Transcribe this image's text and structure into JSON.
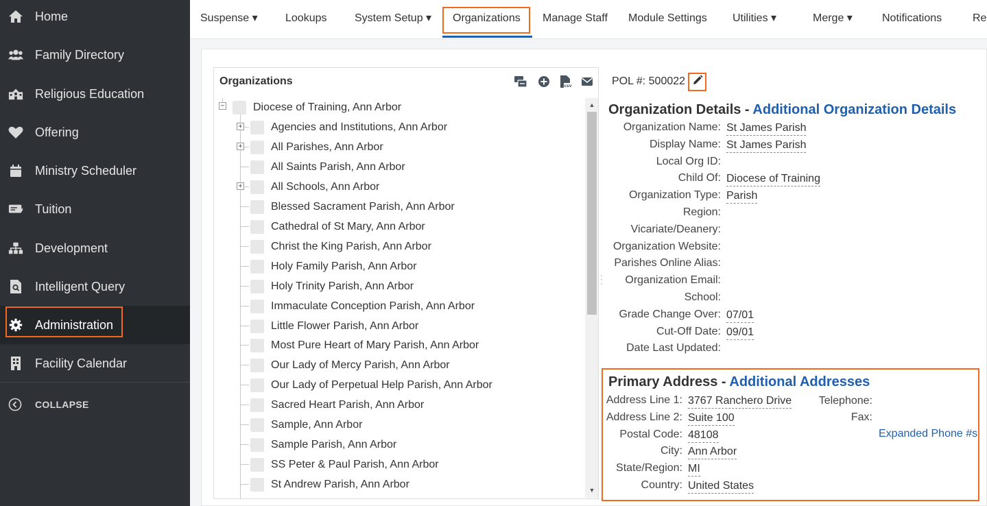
{
  "sidebar": {
    "items": [
      {
        "label": "Home",
        "icon": "home-icon"
      },
      {
        "label": "Family Directory",
        "icon": "users-icon"
      },
      {
        "label": "Religious Education",
        "icon": "school-icon"
      },
      {
        "label": "Offering",
        "icon": "heart-icon"
      },
      {
        "label": "Ministry Scheduler",
        "icon": "calendar-icon"
      },
      {
        "label": "Tuition",
        "icon": "money-icon"
      },
      {
        "label": "Development",
        "icon": "org-chart-icon"
      },
      {
        "label": "Intelligent Query",
        "icon": "query-doc-icon"
      },
      {
        "label": "Administration",
        "icon": "gear-icon"
      },
      {
        "label": "Facility Calendar",
        "icon": "building-icon"
      }
    ],
    "collapse_label": "COLLAPSE"
  },
  "topnav": {
    "items": [
      {
        "label": "Suspense ▾"
      },
      {
        "label": "Lookups"
      },
      {
        "label": "System Setup ▾"
      },
      {
        "label": "Organizations"
      },
      {
        "label": "Manage Staff"
      },
      {
        "label": "Module Settings"
      },
      {
        "label": "Utilities ▾"
      },
      {
        "label": "Merge ▾"
      },
      {
        "label": "Notifications"
      },
      {
        "label": "Rep"
      }
    ]
  },
  "tree": {
    "title": "Organizations",
    "tools": [
      "transfer-icon",
      "add-circle-icon",
      "csv-file-icon",
      "mail-icon"
    ],
    "root": "Diocese of Training, Ann Arbor",
    "items": [
      {
        "label": "Agencies and Institutions, Ann Arbor",
        "expandable": true
      },
      {
        "label": "All Parishes, Ann Arbor",
        "expandable": true
      },
      {
        "label": "All Saints Parish, Ann Arbor",
        "expandable": false
      },
      {
        "label": "All Schools, Ann Arbor",
        "expandable": true
      },
      {
        "label": "Blessed Sacrament Parish, Ann Arbor",
        "expandable": false
      },
      {
        "label": "Cathedral of St Mary, Ann Arbor",
        "expandable": false
      },
      {
        "label": "Christ the King Parish, Ann Arbor",
        "expandable": false
      },
      {
        "label": "Holy Family Parish, Ann Arbor",
        "expandable": false
      },
      {
        "label": "Holy Trinity Parish, Ann Arbor",
        "expandable": false
      },
      {
        "label": "Immaculate Conception Parish, Ann Arbor",
        "expandable": false
      },
      {
        "label": "Little Flower Parish, Ann Arbor",
        "expandable": false
      },
      {
        "label": "Most Pure Heart of Mary Parish, Ann Arbor",
        "expandable": false
      },
      {
        "label": "Our Lady of Mercy Parish, Ann Arbor",
        "expandable": false
      },
      {
        "label": "Our Lady of Perpetual Help Parish, Ann Arbor",
        "expandable": false
      },
      {
        "label": "Sacred Heart Parish, Ann Arbor",
        "expandable": false
      },
      {
        "label": "Sample, Ann Arbor",
        "expandable": false
      },
      {
        "label": "Sample Parish, Ann Arbor",
        "expandable": false
      },
      {
        "label": "SS Peter & Paul Parish, Ann Arbor",
        "expandable": false
      },
      {
        "label": "St Andrew Parish, Ann Arbor",
        "expandable": false
      }
    ]
  },
  "details": {
    "pol": "POL #: 500022",
    "org_title": "Organization Details - ",
    "org_link": "Additional Organization Details",
    "fields": [
      {
        "label": "Organization Name:",
        "value": "St James Parish"
      },
      {
        "label": "Display Name:",
        "value": "St James Parish"
      },
      {
        "label": "Local Org ID:",
        "value": ""
      },
      {
        "label": "Child Of:",
        "value": "Diocese of Training"
      },
      {
        "label": "Organization Type:",
        "value": "Parish"
      },
      {
        "label": "Region:",
        "value": ""
      },
      {
        "label": "Vicariate/Deanery:",
        "value": ""
      },
      {
        "label": "Organization Website:",
        "value": ""
      },
      {
        "label": "Parishes Online Alias:",
        "value": ""
      },
      {
        "label": "Organization Email:",
        "value": ""
      },
      {
        "label": "School:",
        "value": ""
      },
      {
        "label": "Grade Change Over:",
        "value": "07/01"
      },
      {
        "label": "Cut-Off Date:",
        "value": "09/01"
      },
      {
        "label": "Date Last Updated:",
        "value": ""
      }
    ],
    "addr_title": "Primary Address - ",
    "addr_link": "Additional Addresses",
    "address": [
      {
        "label": "Address Line 1:",
        "value": "3767 Ranchero Drive"
      },
      {
        "label": "Address Line 2:",
        "value": "Suite 100"
      },
      {
        "label": "Postal Code:",
        "value": "48108"
      },
      {
        "label": "City:",
        "value": "Ann Arbor"
      },
      {
        "label": "State/Region:",
        "value": "MI"
      },
      {
        "label": "Country:",
        "value": "United States"
      }
    ],
    "phone": [
      {
        "label": "Telephone:"
      },
      {
        "label": "Fax:"
      }
    ],
    "phone_link": "Expanded Phone #s"
  },
  "colors": {
    "sidebar_bg": "#2e3135",
    "highlight": "#f26a21",
    "link": "#1f5fae"
  }
}
